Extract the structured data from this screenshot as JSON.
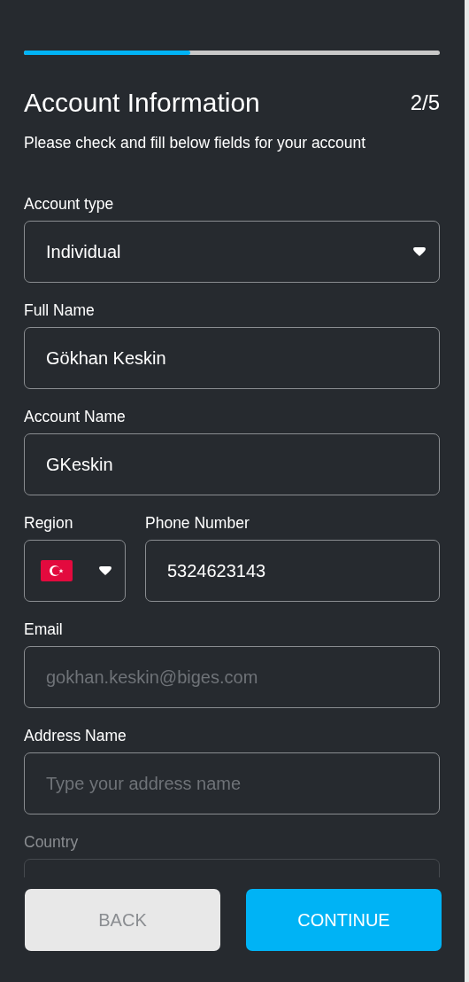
{
  "progress": {
    "level": 0.4
  },
  "header": {
    "title": "Account Information",
    "step": "2/5",
    "subtitle": "Please check and fill below fields for your account"
  },
  "fields": [
    {
      "kind": "select",
      "label": "Account type",
      "value": "Individual"
    },
    {
      "kind": "text",
      "label": "Full Name",
      "value": "Gökhan Keskin"
    },
    {
      "kind": "text",
      "label": "Account Name",
      "value": "GKeskin"
    },
    {
      "kind": "phone",
      "label": "Region",
      "phone_label": "Phone Number",
      "value": "5324623143"
    },
    {
      "kind": "text",
      "label": "Email",
      "placeholder": "gokhan.keskin@biges.com"
    },
    {
      "kind": "text",
      "label": "Address Name",
      "placeholder": "Type your address name"
    },
    {
      "kind": "text",
      "label": "Country",
      "faded": true
    }
  ],
  "buttons": [
    {
      "kind": "secondary",
      "label": "BACK"
    },
    {
      "kind": "primary",
      "label": "CONTINUE"
    }
  ]
}
